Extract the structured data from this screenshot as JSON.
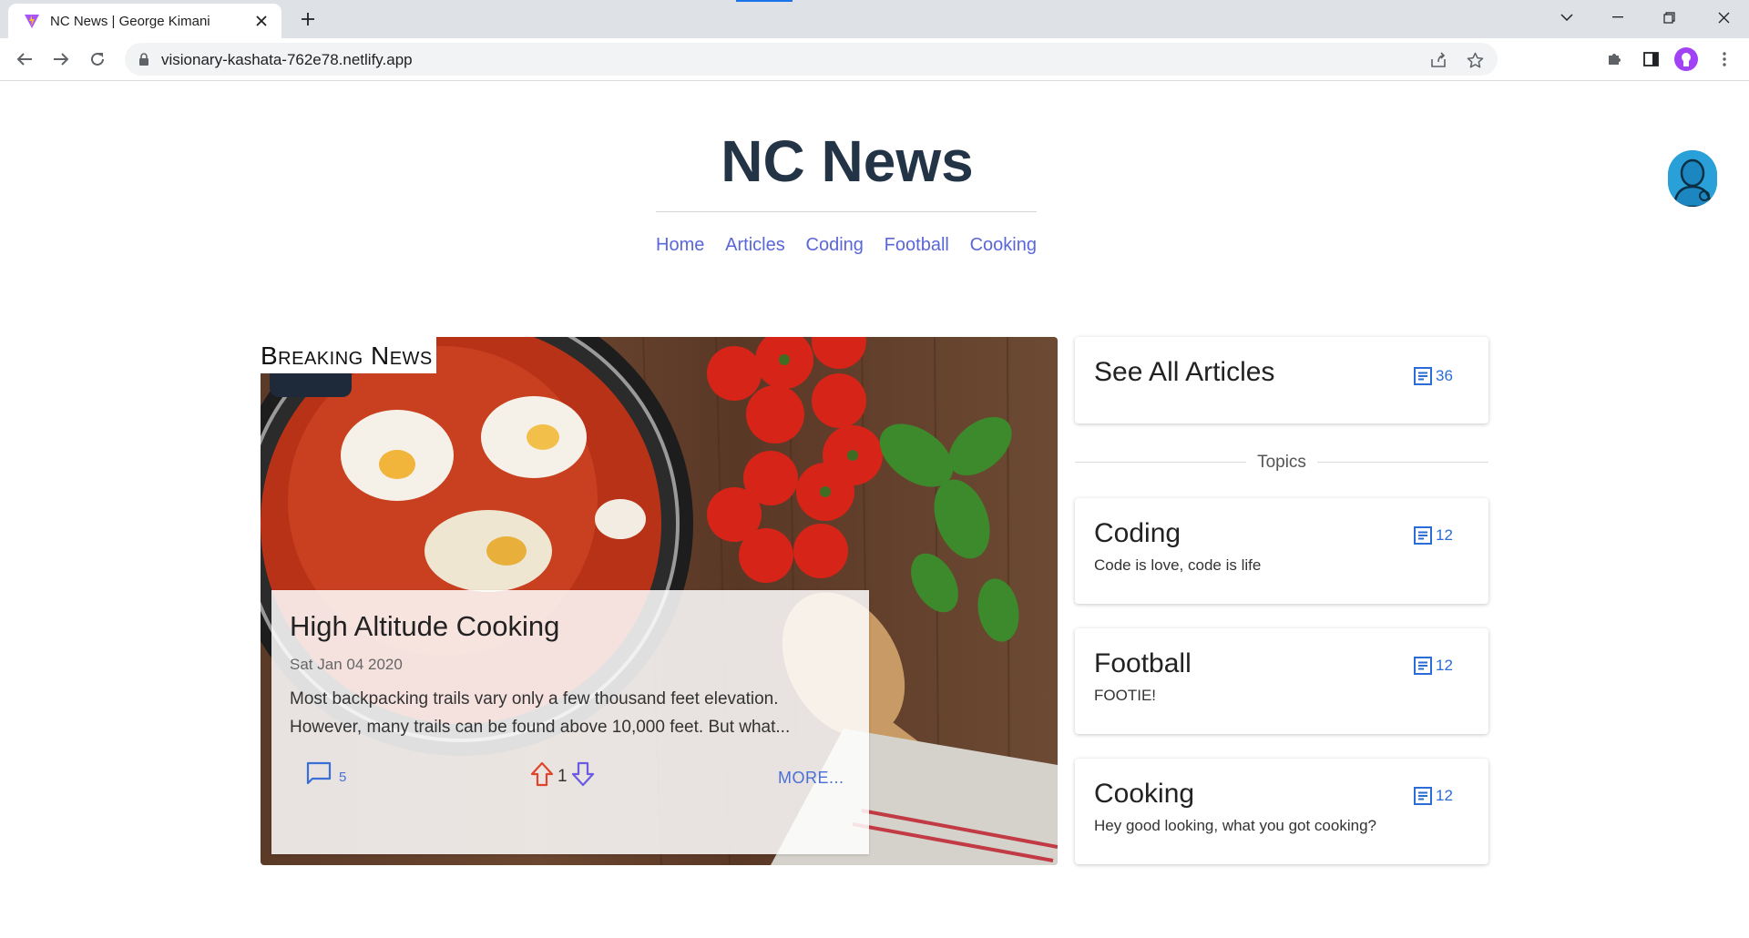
{
  "browser": {
    "tab_title": "NC News | George Kimani",
    "url": "visionary-kashata-762e78.netlify.app"
  },
  "site": {
    "title": "NC News",
    "nav": [
      "Home",
      "Articles",
      "Coding",
      "Football",
      "Cooking"
    ]
  },
  "hero": {
    "badge": "Breaking News",
    "article": {
      "title": "High Altitude Cooking",
      "date": "Sat Jan 04 2020",
      "excerpt": "Most backpacking trails vary only a few thousand feet elevation. However, many trails can be found above 10,000 feet. But what...",
      "comment_count": "5",
      "votes": "1",
      "more_label": "MORE..."
    }
  },
  "sidebar": {
    "all_articles": {
      "title": "See All Articles",
      "count": "36"
    },
    "topics_label": "Topics",
    "topics": [
      {
        "title": "Coding",
        "description": "Code is love, code is life",
        "count": "12"
      },
      {
        "title": "Football",
        "description": "FOOTIE!",
        "count": "12"
      },
      {
        "title": "Cooking",
        "description": "Hey good looking, what you got cooking?",
        "count": "12"
      }
    ]
  },
  "colors": {
    "title": "#243447",
    "nav_link": "#5a67d8",
    "accent_blue": "#2b6cd6",
    "upvote": "#e0442a",
    "downvote": "#6a5be0"
  },
  "icons": {
    "back": "arrow-left-icon",
    "forward": "arrow-right-icon",
    "reload": "reload-icon",
    "lock": "lock-icon",
    "share": "share-icon",
    "star": "star-icon",
    "extensions": "puzzle-icon",
    "sidepanel": "side-panel-icon",
    "menu": "kebab-menu-icon",
    "comments": "comment-icon",
    "upvote": "arrow-up-icon",
    "downvote": "arrow-down-icon",
    "articles": "article-list-icon"
  }
}
